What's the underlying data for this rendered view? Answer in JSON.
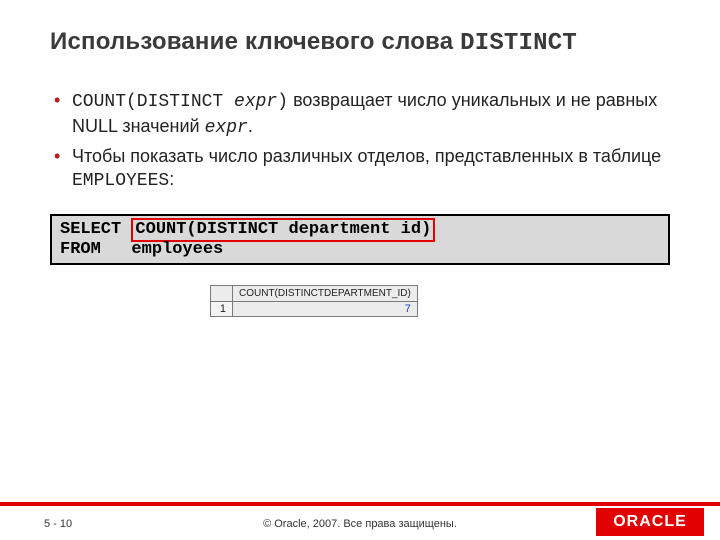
{
  "title_plain": "Использование ключевого слова ",
  "title_mono": "DISTINCT",
  "bullets": [
    {
      "pre_mono": "COUNT(DISTINCT ",
      "mono_i": "expr",
      "post_mono": ")",
      "mid": " возвращает число уникальных и не равных NULL значений ",
      "mono_i2": "expr",
      "tail": "."
    },
    {
      "pre": "Чтобы показать число различных отделов, представленных в таблице ",
      "mono": "EMPLOYEES",
      "tail": ":"
    }
  ],
  "code": {
    "kw_select": "SELECT",
    "hl": "COUNT(DISTINCT department id)",
    "kw_from": "FROM   ",
    "tbl": "employees"
  },
  "result": {
    "col_header": "COUNT(DISTINCTDEPARTMENT_ID)",
    "row_num": "1",
    "value": "7"
  },
  "footer": {
    "page": "5 - 10",
    "copyright": "© Oracle, 2007. Все права защищены.",
    "logo": "ORACLE"
  }
}
